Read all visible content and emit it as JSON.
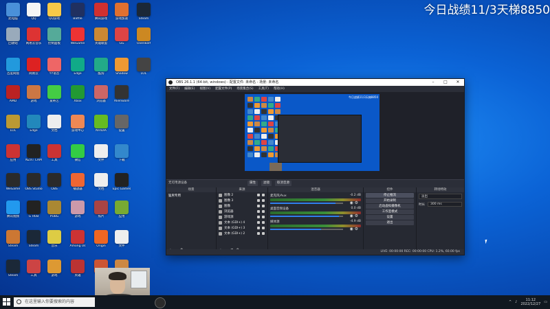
{
  "overlay_text": "今日战绩11/3天梯8850",
  "desktop_icons": [
    {
      "label": "此电脑",
      "color": "#4a90d9"
    },
    {
      "label": "QQ",
      "color": "#f5f5f5"
    },
    {
      "label": "QQ游戏",
      "color": "#f7c948"
    },
    {
      "label": "Battle",
      "color": "#203060"
    },
    {
      "label": "腾讯游戏",
      "color": "#d03030"
    },
    {
      "label": "游戏加速",
      "color": "#e07030"
    },
    {
      "label": "Steam",
      "color": "#1b2838"
    },
    {
      "label": "回收站",
      "color": "#9ab"
    },
    {
      "label": "网易云音乐",
      "color": "#d33"
    },
    {
      "label": "控制面板",
      "color": "#5a9"
    },
    {
      "label": "WeGame",
      "color": "#e33"
    },
    {
      "label": "英雄联盟",
      "color": "#c83"
    },
    {
      "label": "GG",
      "color": "#d44"
    },
    {
      "label": "Overwolf",
      "color": "#c82"
    },
    {
      "label": "百度网盘",
      "color": "#29d"
    },
    {
      "label": "网易云",
      "color": "#d22"
    },
    {
      "label": "YY语音",
      "color": "#e66"
    },
    {
      "label": "Edge",
      "color": "#1a8"
    },
    {
      "label": "酷狗",
      "color": "#2a8"
    },
    {
      "label": "Shadow",
      "color": "#e93"
    },
    {
      "label": "LOL",
      "color": "#444"
    },
    {
      "label": "AMD",
      "color": "#b22"
    },
    {
      "label": "游戏",
      "color": "#c74"
    },
    {
      "label": "爱奇艺",
      "color": "#4c4"
    },
    {
      "label": "Xbox",
      "color": "#293"
    },
    {
      "label": "浏览器",
      "color": "#c66"
    },
    {
      "label": "Alienware",
      "color": "#333"
    },
    {
      "label": "LOL",
      "color": "#b93"
    },
    {
      "label": "Edge",
      "color": "#28b"
    },
    {
      "label": "文档",
      "color": "#eee"
    },
    {
      "label": "游戏中心",
      "color": "#e85"
    },
    {
      "label": "NVIDIA",
      "color": "#6b2"
    },
    {
      "label": "设置",
      "color": "#666"
    },
    {
      "label": "应用",
      "color": "#c33"
    },
    {
      "label": "NZXT CAM",
      "color": "#222"
    },
    {
      "label": "工具",
      "color": "#c33"
    },
    {
      "label": "微信",
      "color": "#3c4"
    },
    {
      "label": "文件",
      "color": "#eee"
    },
    {
      "label": "下载",
      "color": "#38c"
    },
    {
      "label": "WeGame",
      "color": "#2a2a2a"
    },
    {
      "label": "OBS Studio",
      "color": "#2a2a2a"
    },
    {
      "label": "OBS",
      "color": "#2a2a2a"
    },
    {
      "label": "播放器",
      "color": "#e63"
    },
    {
      "label": "文档",
      "color": "#eee"
    },
    {
      "label": "Epic Games",
      "color": "#222"
    },
    {
      "label": "腾讯视频",
      "color": "#29e"
    },
    {
      "label": "G HUB",
      "color": "#222"
    },
    {
      "label": "PUBG",
      "color": "#a83"
    },
    {
      "label": "游戏",
      "color": "#c9a"
    },
    {
      "label": "照片",
      "color": "#a44"
    },
    {
      "label": "应用",
      "color": "#7a3"
    },
    {
      "label": "Steam",
      "color": "#c73"
    },
    {
      "label": "Steam",
      "color": "#1b2838"
    },
    {
      "label": "音乐",
      "color": "#dc4"
    },
    {
      "label": "Among Us",
      "color": "#c33"
    },
    {
      "label": "Origin",
      "color": "#e62"
    },
    {
      "label": "文件",
      "color": "#eee"
    },
    {
      "label": "Steam",
      "color": "#1b2838"
    },
    {
      "label": "工具",
      "color": "#c44"
    },
    {
      "label": "游戏",
      "color": "#d93"
    },
    {
      "label": "英雄",
      "color": "#b33"
    },
    {
      "label": "应用",
      "color": "#c53"
    },
    {
      "label": "游戏",
      "color": "#c84"
    }
  ],
  "obs": {
    "title": "OBS 26.1.1 (64-bit, windows) - 配置文件: 未命名 - 场景: 未命名",
    "menu": [
      "文件(F)",
      "编辑(E)",
      "视图(V)",
      "配置文件(P)",
      "场景集合(S)",
      "工具(T)",
      "帮助(H)"
    ],
    "preview_overlay": "今日战绩11/3天梯8850",
    "toolbar": {
      "source_label": "无可用源设备",
      "btn1": "属性",
      "btn2": "滤镜",
      "btn3": "取消音源"
    },
    "docks": {
      "scenes": {
        "title": "场景",
        "items": [
          "猛男专用"
        ]
      },
      "sources": {
        "title": "来源",
        "items": [
          "图像 2",
          "图像 3",
          "图像",
          "浏览器",
          "游戏源",
          "文本 (GDI+) 4",
          "文本 (GDI+) 3",
          "文本 (GDI+) 2"
        ]
      },
      "mixer": {
        "title": "混音器",
        "rows": [
          {
            "name": "麦克风/Aux",
            "db": "-0.2 dB",
            "vol": 0.9
          },
          {
            "name": "桌面音频设备",
            "db": "0.0 dB",
            "vol": 0.95
          },
          {
            "name": "媒体源",
            "db": "-4.9 dB",
            "vol": 0.7
          }
        ]
      },
      "transitions": {
        "title": "转场特效",
        "type": "淡出",
        "duration_label": "时长",
        "duration": "300 ms"
      },
      "controls": {
        "title": "控件",
        "buttons": [
          "停止推流",
          "开始录制",
          "启动虚拟摄像机",
          "工作室模式",
          "设置",
          "退出"
        ]
      }
    },
    "statusbar": "LIVE: 00:00:00  REC: 00:00:00  CPU: 1.2%, 60.00 fps"
  },
  "taskbar": {
    "search_placeholder": "在这里输入你要搜索的内容",
    "time": "11:12",
    "date": "2022/12/27"
  }
}
